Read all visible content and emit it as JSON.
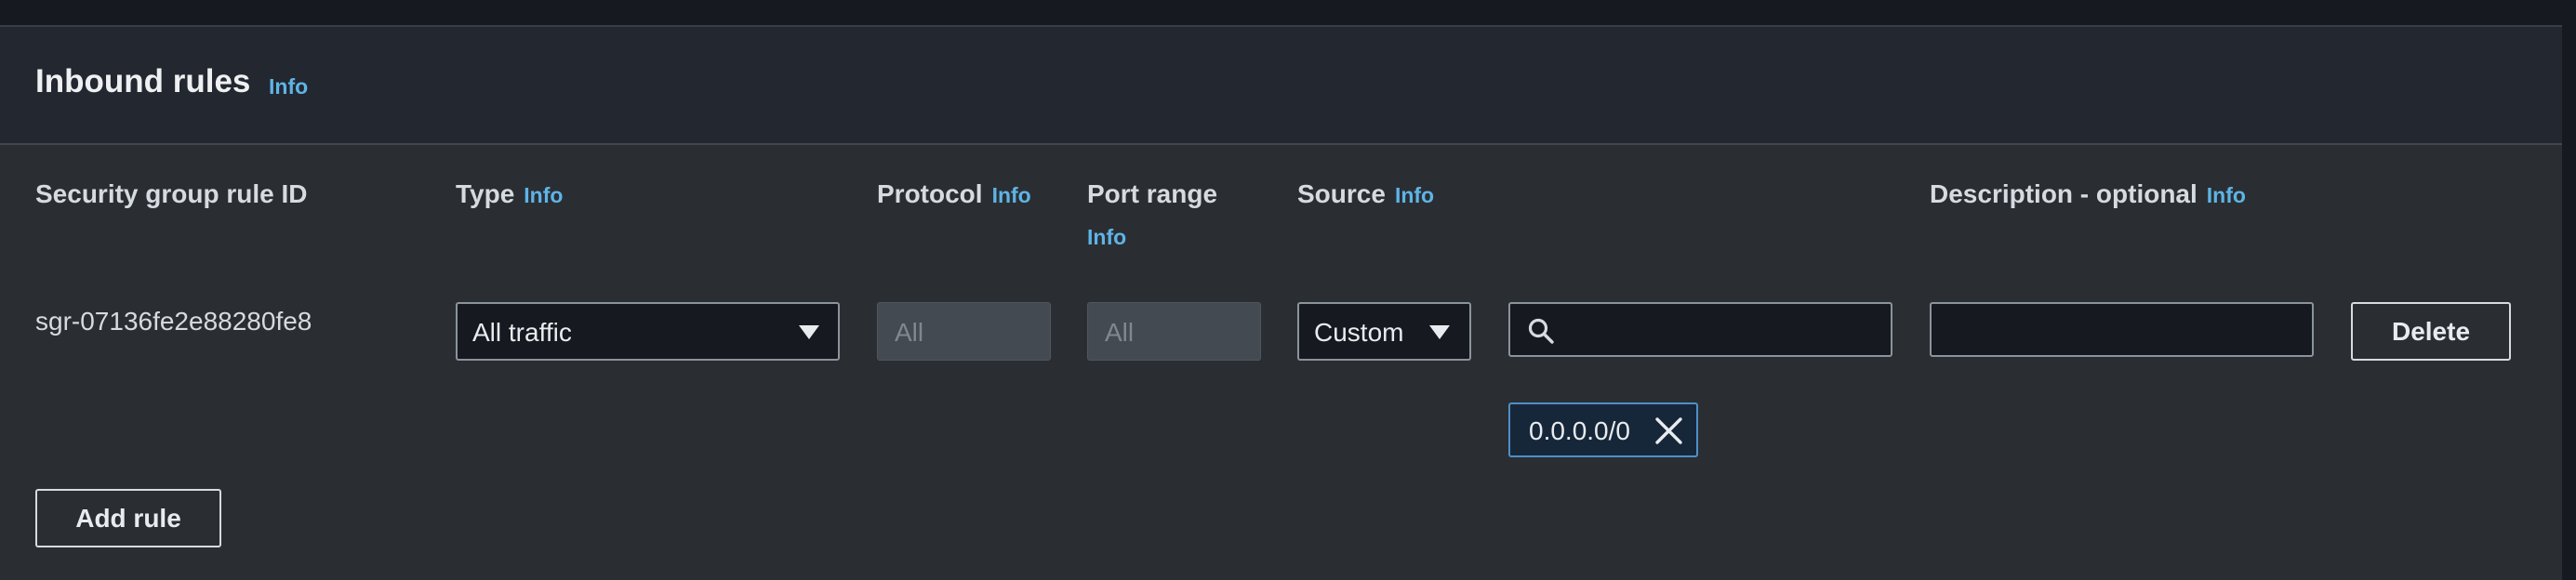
{
  "section": {
    "title": "Inbound rules",
    "info_label": "Info"
  },
  "columns": {
    "rule_id": "Security group rule ID",
    "type": "Type",
    "protocol": "Protocol",
    "port_range": "Port range",
    "source": "Source",
    "description": "Description - optional",
    "info_label": "Info"
  },
  "rule": {
    "id": "sgr-07136fe2e88280fe8",
    "type_value": "All traffic",
    "protocol_value": "All",
    "port_range_value": "All",
    "source_type_value": "Custom",
    "source_search_value": "",
    "source_token": "0.0.0.0/0",
    "description_value": "",
    "delete_label": "Delete"
  },
  "actions": {
    "add_rule_label": "Add rule"
  },
  "icons": {
    "search": "search-icon",
    "dismiss": "close-icon",
    "caret": "caret-down-icon"
  },
  "colors": {
    "info_link": "#5fb4e6",
    "token_border": "#4f90c6",
    "panel_bg": "#2a2e33",
    "header_bg": "#232730"
  }
}
